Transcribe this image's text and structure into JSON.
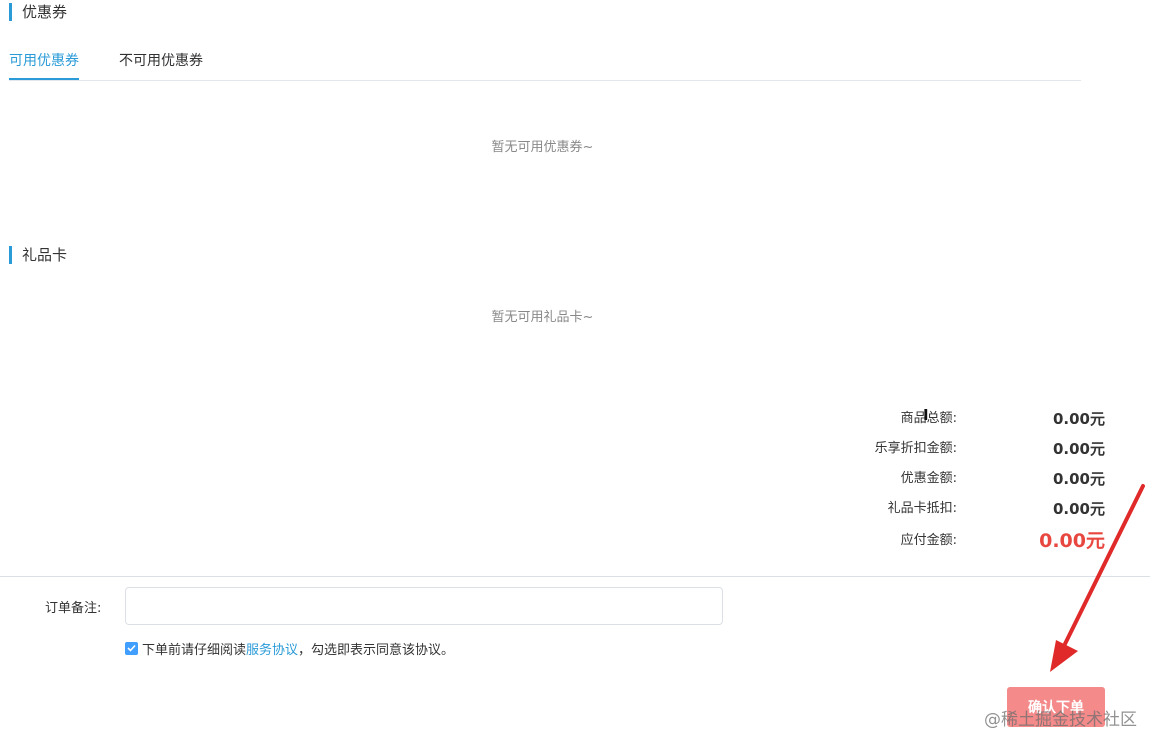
{
  "coupon_section": {
    "title": "优惠券",
    "tabs": [
      {
        "label": "可用优惠券",
        "active": true
      },
      {
        "label": "不可用优惠券",
        "active": false
      }
    ],
    "empty_text": "暂无可用优惠券~"
  },
  "giftcard_section": {
    "title": "礼品卡",
    "empty_text": "暂无可用礼品卡~"
  },
  "summary": {
    "rows": [
      {
        "label": "商品总额:",
        "value": "0.00元"
      },
      {
        "label": "乐享折扣金额:",
        "value": "0.00元"
      },
      {
        "label": "优惠金额:",
        "value": "0.00元"
      },
      {
        "label": "礼品卡抵扣:",
        "value": "0.00元"
      }
    ],
    "total": {
      "label": "应付金额:",
      "value": "0.00元"
    }
  },
  "order": {
    "remark_label": "订单备注:",
    "remark_value": "",
    "remark_placeholder": "",
    "agreement_checked": true,
    "agreement_prefix": "下单前请仔细阅读",
    "agreement_link": "服务协议",
    "agreement_suffix": "，勾选即表示同意该协议。",
    "confirm_label": "确认下单"
  },
  "watermark": "@稀土掘金技术社区",
  "colors": {
    "accent": "#2a9bd7",
    "total_price": "#e8473f",
    "confirm_button": "#f48a8a",
    "checkbox": "#409eff",
    "annotation_arrow": "#e02a2a"
  },
  "icons": {
    "checkbox": "check-icon",
    "cursor": "text-cursor-icon",
    "annotation": "red-arrow-icon"
  }
}
